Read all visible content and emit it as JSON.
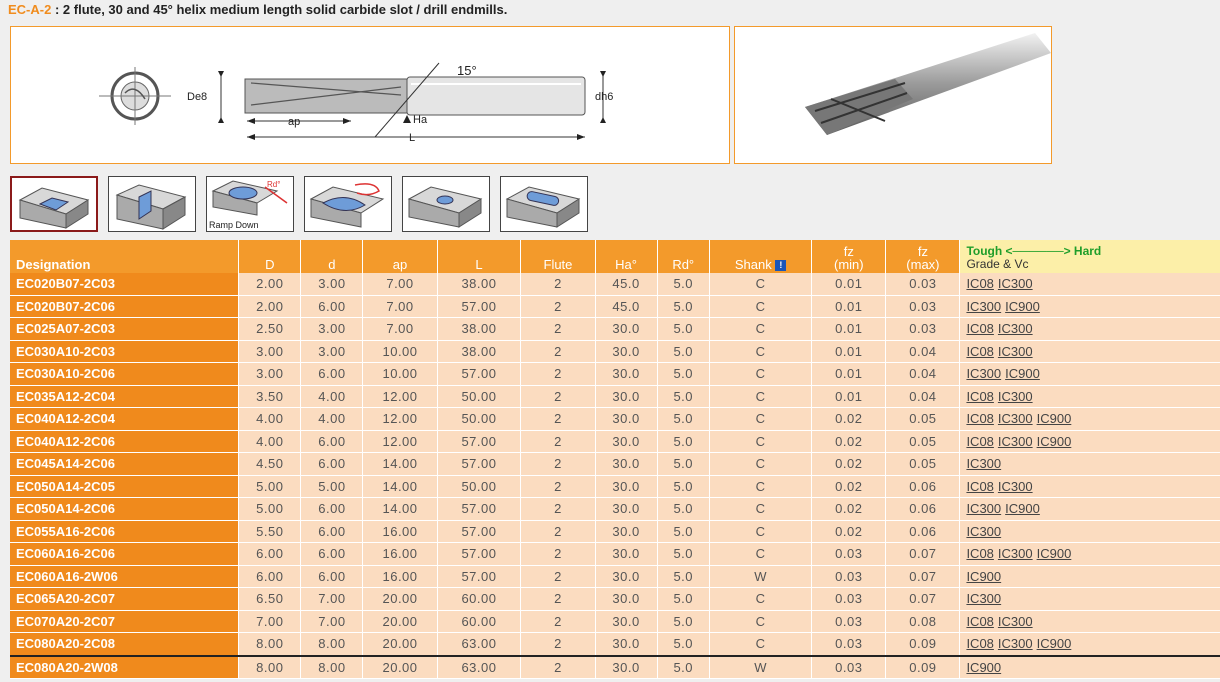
{
  "header": {
    "code": "EC-A-2",
    "sep": " : ",
    "text": "2 flute, 30 and 45° helix medium length solid carbide slot / drill endmills."
  },
  "drawing": {
    "angle_label": "15°",
    "d_label": "De8",
    "dh_label": "dh6",
    "ap_label": "ap",
    "ha_label": "Ha",
    "l_label": "L"
  },
  "tiles": [
    {
      "icon": "slot-milling-icon",
      "label": ""
    },
    {
      "icon": "shoulder-milling-icon",
      "label": ""
    },
    {
      "icon": "ramp-down-icon",
      "label": "Ramp Down",
      "rd_label": "Rd°"
    },
    {
      "icon": "helical-interpolation-icon",
      "label": ""
    },
    {
      "icon": "drilling-icon",
      "label": ""
    },
    {
      "icon": "pocket-slot-icon",
      "label": ""
    }
  ],
  "table": {
    "headers": {
      "designation": "Designation",
      "D": "D",
      "d": "d",
      "ap": "ap",
      "L": "L",
      "flute": "Flute",
      "ha": "Ha°",
      "rd": "Rd°",
      "shank": "Shank",
      "fz_min_1": "fz",
      "fz_min_2": "(min)",
      "fz_max_1": "fz",
      "fz_max_2": "(max)",
      "tough": "Tough",
      "hard": "Hard",
      "grade": "Grade & Vc"
    },
    "rows": [
      {
        "designation": "EC020B07-2C03",
        "D": "2.00",
        "d": "3.00",
        "ap": "7.00",
        "L": "38.00",
        "flute": "2",
        "ha": "45.0",
        "rd": "5.0",
        "shank": "C",
        "fzmin": "0.01",
        "fzmax": "0.03",
        "grades": [
          "IC08",
          "IC300"
        ]
      },
      {
        "designation": "EC020B07-2C06",
        "D": "2.00",
        "d": "6.00",
        "ap": "7.00",
        "L": "57.00",
        "flute": "2",
        "ha": "45.0",
        "rd": "5.0",
        "shank": "C",
        "fzmin": "0.01",
        "fzmax": "0.03",
        "grades": [
          "IC300",
          "IC900"
        ]
      },
      {
        "designation": "EC025A07-2C03",
        "D": "2.50",
        "d": "3.00",
        "ap": "7.00",
        "L": "38.00",
        "flute": "2",
        "ha": "30.0",
        "rd": "5.0",
        "shank": "C",
        "fzmin": "0.01",
        "fzmax": "0.03",
        "grades": [
          "IC08",
          "IC300"
        ]
      },
      {
        "designation": "EC030A10-2C03",
        "D": "3.00",
        "d": "3.00",
        "ap": "10.00",
        "L": "38.00",
        "flute": "2",
        "ha": "30.0",
        "rd": "5.0",
        "shank": "C",
        "fzmin": "0.01",
        "fzmax": "0.04",
        "grades": [
          "IC08",
          "IC300"
        ]
      },
      {
        "designation": "EC030A10-2C06",
        "D": "3.00",
        "d": "6.00",
        "ap": "10.00",
        "L": "57.00",
        "flute": "2",
        "ha": "30.0",
        "rd": "5.0",
        "shank": "C",
        "fzmin": "0.01",
        "fzmax": "0.04",
        "grades": [
          "IC300",
          "IC900"
        ]
      },
      {
        "designation": "EC035A12-2C04",
        "D": "3.50",
        "d": "4.00",
        "ap": "12.00",
        "L": "50.00",
        "flute": "2",
        "ha": "30.0",
        "rd": "5.0",
        "shank": "C",
        "fzmin": "0.01",
        "fzmax": "0.04",
        "grades": [
          "IC08",
          "IC300"
        ]
      },
      {
        "designation": "EC040A12-2C04",
        "D": "4.00",
        "d": "4.00",
        "ap": "12.00",
        "L": "50.00",
        "flute": "2",
        "ha": "30.0",
        "rd": "5.0",
        "shank": "C",
        "fzmin": "0.02",
        "fzmax": "0.05",
        "grades": [
          "IC08",
          "IC300",
          "IC900"
        ]
      },
      {
        "designation": "EC040A12-2C06",
        "D": "4.00",
        "d": "6.00",
        "ap": "12.00",
        "L": "57.00",
        "flute": "2",
        "ha": "30.0",
        "rd": "5.0",
        "shank": "C",
        "fzmin": "0.02",
        "fzmax": "0.05",
        "grades": [
          "IC08",
          "IC300",
          "IC900"
        ]
      },
      {
        "designation": "EC045A14-2C06",
        "D": "4.50",
        "d": "6.00",
        "ap": "14.00",
        "L": "57.00",
        "flute": "2",
        "ha": "30.0",
        "rd": "5.0",
        "shank": "C",
        "fzmin": "0.02",
        "fzmax": "0.05",
        "grades": [
          "IC300"
        ]
      },
      {
        "designation": "EC050A14-2C05",
        "D": "5.00",
        "d": "5.00",
        "ap": "14.00",
        "L": "50.00",
        "flute": "2",
        "ha": "30.0",
        "rd": "5.0",
        "shank": "C",
        "fzmin": "0.02",
        "fzmax": "0.06",
        "grades": [
          "IC08",
          "IC300"
        ]
      },
      {
        "designation": "EC050A14-2C06",
        "D": "5.00",
        "d": "6.00",
        "ap": "14.00",
        "L": "57.00",
        "flute": "2",
        "ha": "30.0",
        "rd": "5.0",
        "shank": "C",
        "fzmin": "0.02",
        "fzmax": "0.06",
        "grades": [
          "IC300",
          "IC900"
        ]
      },
      {
        "designation": "EC055A16-2C06",
        "D": "5.50",
        "d": "6.00",
        "ap": "16.00",
        "L": "57.00",
        "flute": "2",
        "ha": "30.0",
        "rd": "5.0",
        "shank": "C",
        "fzmin": "0.02",
        "fzmax": "0.06",
        "grades": [
          "IC300"
        ]
      },
      {
        "designation": "EC060A16-2C06",
        "D": "6.00",
        "d": "6.00",
        "ap": "16.00",
        "L": "57.00",
        "flute": "2",
        "ha": "30.0",
        "rd": "5.0",
        "shank": "C",
        "fzmin": "0.03",
        "fzmax": "0.07",
        "grades": [
          "IC08",
          "IC300",
          "IC900"
        ]
      },
      {
        "designation": "EC060A16-2W06",
        "D": "6.00",
        "d": "6.00",
        "ap": "16.00",
        "L": "57.00",
        "flute": "2",
        "ha": "30.0",
        "rd": "5.0",
        "shank": "W",
        "fzmin": "0.03",
        "fzmax": "0.07",
        "grades": [
          "IC900"
        ]
      },
      {
        "designation": "EC065A20-2C07",
        "D": "6.50",
        "d": "7.00",
        "ap": "20.00",
        "L": "60.00",
        "flute": "2",
        "ha": "30.0",
        "rd": "5.0",
        "shank": "C",
        "fzmin": "0.03",
        "fzmax": "0.07",
        "grades": [
          "IC300"
        ]
      },
      {
        "designation": "EC070A20-2C07",
        "D": "7.00",
        "d": "7.00",
        "ap": "20.00",
        "L": "60.00",
        "flute": "2",
        "ha": "30.0",
        "rd": "5.0",
        "shank": "C",
        "fzmin": "0.03",
        "fzmax": "0.08",
        "grades": [
          "IC08",
          "IC300"
        ]
      },
      {
        "designation": "EC080A20-2C08",
        "D": "8.00",
        "d": "8.00",
        "ap": "20.00",
        "L": "63.00",
        "flute": "2",
        "ha": "30.0",
        "rd": "5.0",
        "shank": "C",
        "fzmin": "0.03",
        "fzmax": "0.09",
        "grades": [
          "IC08",
          "IC300",
          "IC900"
        ]
      },
      {
        "designation": "EC080A20-2W08",
        "D": "8.00",
        "d": "8.00",
        "ap": "20.00",
        "L": "63.00",
        "flute": "2",
        "ha": "30.0",
        "rd": "5.0",
        "shank": "W",
        "fzmin": "0.03",
        "fzmax": "0.09",
        "grades": [
          "IC900"
        ]
      }
    ]
  }
}
